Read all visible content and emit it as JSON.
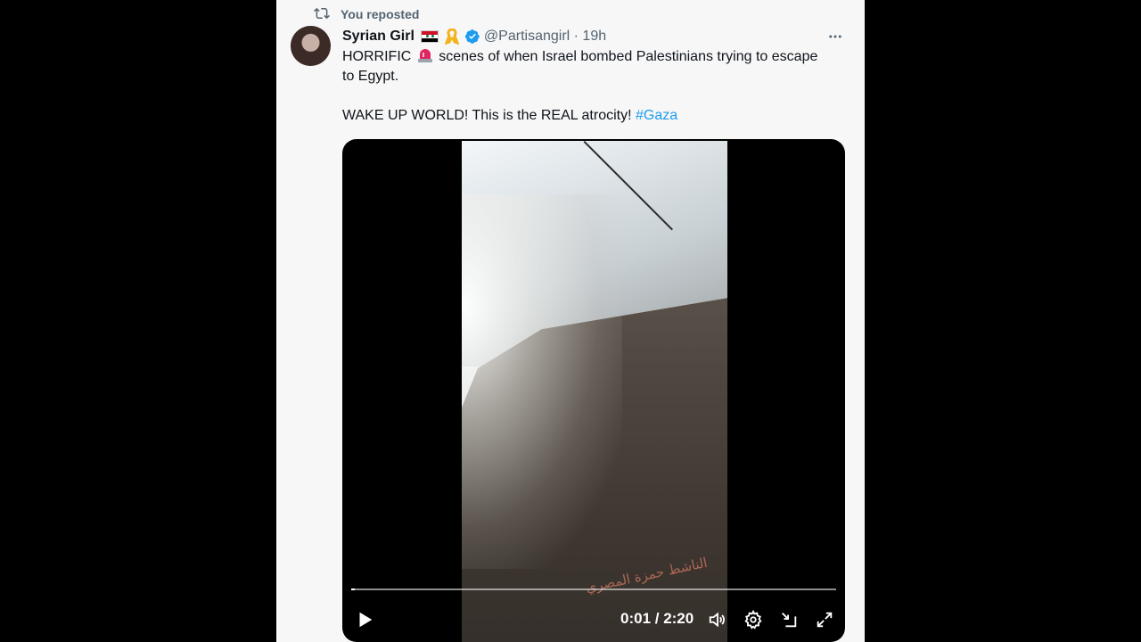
{
  "repost": {
    "label": "You reposted"
  },
  "author": {
    "name": "Syrian Girl",
    "handle_time": "@Partisangirl · 19h"
  },
  "tweet": {
    "line1": "HORRIFIC ",
    "line1b": " scenes of when Israel bombed Palestinians trying to escape",
    "line2": "to Egypt.",
    "line3": "WAKE UP WORLD! This is the REAL atrocity! ",
    "hashtag": "#Gaza"
  },
  "video": {
    "time": "0:01 / 2:20",
    "progress_fraction": 0.007
  },
  "colors": {
    "accent": "#1d9bf0",
    "muted": "#536471",
    "text": "#0f1419"
  },
  "icons": [
    "repost-icon",
    "flag-icon",
    "ribbon-icon",
    "verified-icon",
    "more-icon",
    "siren-icon",
    "play-icon",
    "volume-icon",
    "settings-icon",
    "dock-icon",
    "fullscreen-icon"
  ]
}
